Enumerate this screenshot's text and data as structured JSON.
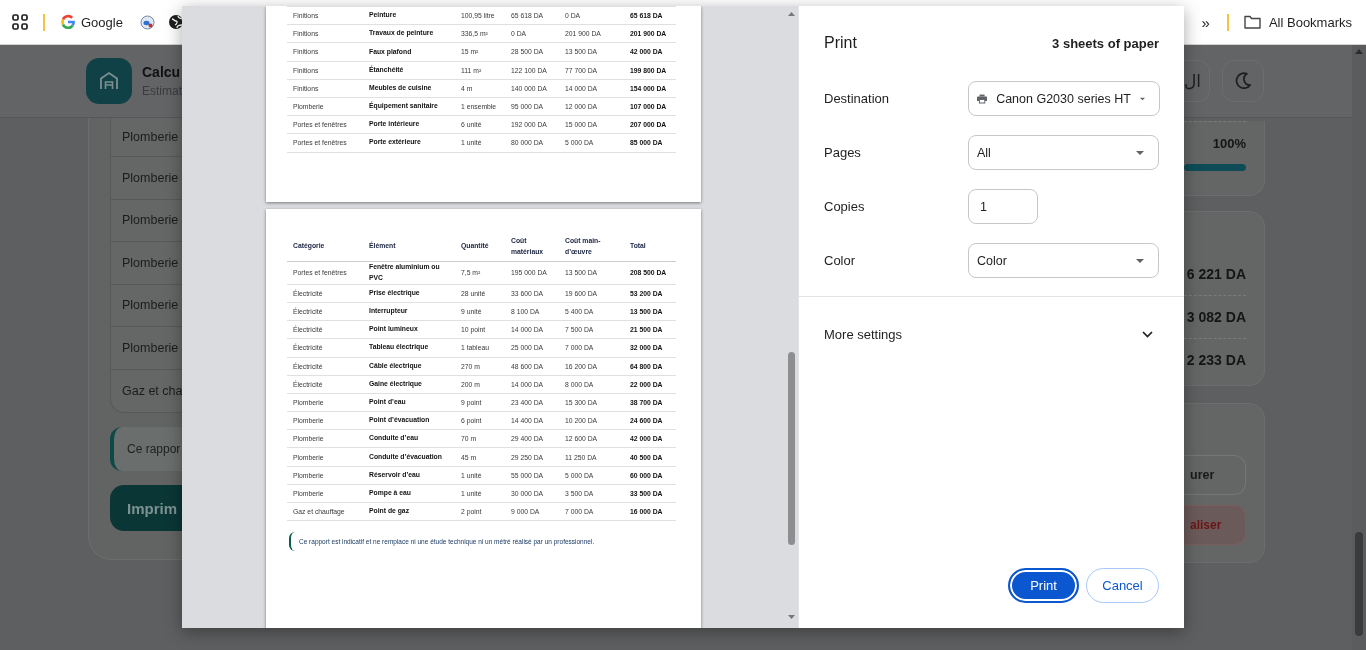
{
  "bookmarks_bar": {
    "bookmarks": [
      {
        "label": "Google"
      }
    ],
    "overflow_label": "»",
    "all_bookmarks": "All Bookmarks"
  },
  "app": {
    "title": "Calcu",
    "subtitle": "Estimat",
    "language_button": "ال",
    "list_rows": [
      "Plomberie",
      "Plomberie",
      "Plomberie",
      "Plomberie",
      "Plomberie",
      "Plomberie",
      "Gaz et cha"
    ],
    "note": "Ce rappor",
    "print_button": "Imprim",
    "progress": {
      "percent": "100%",
      "level": 1
    },
    "totals": [
      "6 221 DA",
      "3 082 DA",
      "2 233 DA"
    ],
    "actions": [
      {
        "label": "urer",
        "kind": "outline"
      },
      {
        "label": "aliser",
        "kind": "danger"
      }
    ]
  },
  "print_dialog": {
    "preview": {
      "pages": [
        {
          "rows": [
            [
              "Finitions",
              "Peinture",
              "100,95 litre",
              "65 618 DA",
              "0 DA",
              "65 618 DA"
            ],
            [
              "Finitions",
              "Travaux de peinture",
              "336,5 m²",
              "0 DA",
              "201 900 DA",
              "201 900 DA"
            ],
            [
              "Finitions",
              "Faux plafond",
              "15 m²",
              "28 500 DA",
              "13 500 DA",
              "42 000 DA"
            ],
            [
              "Finitions",
              "Étanchéité",
              "111 m²",
              "122 100 DA",
              "77 700 DA",
              "199 800 DA"
            ],
            [
              "Finitions",
              "Meubles de cuisine",
              "4 m",
              "140 000 DA",
              "14 000 DA",
              "154 000 DA"
            ],
            [
              "Plomberie",
              "Équipement sanitaire",
              "1 ensemble",
              "95 000 DA",
              "12 000 DA",
              "107 000 DA"
            ],
            [
              "Portes et fenêtres",
              "Porte intérieure",
              "6 unité",
              "192 000 DA",
              "15 000 DA",
              "207 000 DA"
            ],
            [
              "Portes et fenêtres",
              "Porte extérieure",
              "1 unité",
              "80 000 DA",
              "5 000 DA",
              "85 000 DA"
            ]
          ]
        },
        {
          "columns": [
            "Catégorie",
            "Élément",
            "Quantité",
            "Coût matériaux",
            "Coût main-d’œuvre",
            "Total"
          ],
          "rows": [
            [
              "Portes et fenêtres",
              "Fenêtre aluminium ou PVC",
              "7,5 m²",
              "195 000 DA",
              "13 500 DA",
              "208 500 DA"
            ],
            [
              "Électricité",
              "Prise électrique",
              "28 unité",
              "33 600 DA",
              "19 600 DA",
              "53 200 DA"
            ],
            [
              "Électricité",
              "Interrupteur",
              "9 unité",
              "8 100 DA",
              "5 400 DA",
              "13 500 DA"
            ],
            [
              "Électricité",
              "Point lumineux",
              "10 point",
              "14 000 DA",
              "7 500 DA",
              "21 500 DA"
            ],
            [
              "Électricité",
              "Tableau électrique",
              "1 tableau",
              "25 000 DA",
              "7 000 DA",
              "32 000 DA"
            ],
            [
              "Électricité",
              "Câble électrique",
              "270 m",
              "48 600 DA",
              "16 200 DA",
              "64 800 DA"
            ],
            [
              "Électricité",
              "Gaine électrique",
              "200 m",
              "14 000 DA",
              "8 000 DA",
              "22 000 DA"
            ],
            [
              "Plomberie",
              "Point d’eau",
              "9 point",
              "23 400 DA",
              "15 300 DA",
              "38 700 DA"
            ],
            [
              "Plomberie",
              "Point d’évacuation",
              "6 point",
              "14 400 DA",
              "10 200 DA",
              "24 600 DA"
            ],
            [
              "Plomberie",
              "Conduite d’eau",
              "70 m",
              "29 400 DA",
              "12 600 DA",
              "42 000 DA"
            ],
            [
              "Plomberie",
              "Conduite d’évacuation",
              "45 m",
              "29 250 DA",
              "11 250 DA",
              "40 500 DA"
            ],
            [
              "Plomberie",
              "Réservoir d’eau",
              "1 unité",
              "55 000 DA",
              "5 000 DA",
              "60 000 DA"
            ],
            [
              "Plomberie",
              "Pompe à eau",
              "1 unité",
              "30 000 DA",
              "3 500 DA",
              "33 500 DA"
            ],
            [
              "Gaz et chauffage",
              "Point de gaz",
              "2 point",
              "9 000 DA",
              "7 000 DA",
              "16 000 DA"
            ]
          ],
          "note": "Ce rapport est indicatif et ne remplace ni une étude technique ni un métré réalisé par un professionnel."
        }
      ]
    },
    "settings": {
      "title": "Print",
      "sheets": "3 sheets of paper",
      "fields": [
        {
          "label": "Destination",
          "kind": "select",
          "value": "Canon G2030 series HT"
        },
        {
          "label": "Pages",
          "kind": "select",
          "value": "All"
        },
        {
          "label": "Copies",
          "kind": "number",
          "value": "1"
        },
        {
          "label": "Color",
          "kind": "select",
          "value": "Color"
        }
      ],
      "more_settings": {
        "label": "More settings",
        "expanded": false
      },
      "buttons": [
        {
          "label": "Print",
          "kind": "primary"
        },
        {
          "label": "Cancel",
          "kind": "secondary"
        }
      ]
    }
  }
}
